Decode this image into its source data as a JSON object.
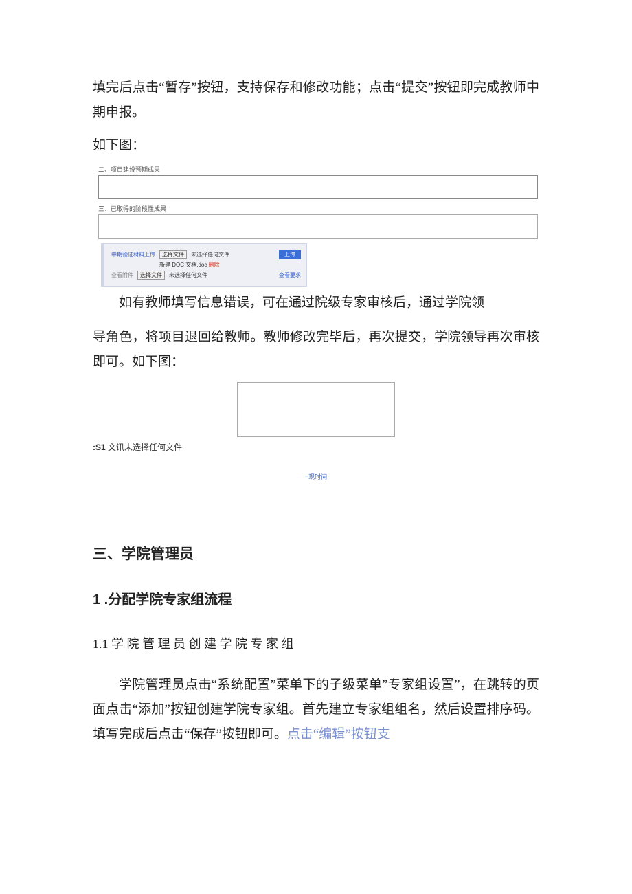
{
  "paragraphs": {
    "p1": "填完后点击“暂存”按钮，支持保存和修改功能；点击“提交”按钮即完成教师中期申报。",
    "caption1": "如下图：",
    "return1_prefix": "如有教师填写信息错误，可在通过院级专家审核后，通过学院领",
    "return2": "导角色，将项目退回给教师。教师修改完毕后，再次提交，学院领导再次审核即可。如下图：",
    "admin_para_a": "学院管理员点击“系统配置”菜单下的子级菜单”专家组设置”，在跳转的页面点击“添加”按钮创建学院专家组。首先建立专家组组名，然后设置排序码。填写完成后点击“保存”按钮即可。",
    "admin_para_b": "点击“编辑”按钮支"
  },
  "embed1": {
    "sec2_label": "二、项目建设预期成果",
    "sec3_label": "三、已取得的阶段性成果",
    "row1_label": "中期验证材料上传",
    "file_btn": "选择文件",
    "file_none": "未选择任何文件",
    "upload_btn": "上传",
    "docname_prefix": "新建 DOC 文档.doc",
    "delete": "删除",
    "row2_label": "查看附件",
    "check_req": "查看要求"
  },
  "embed2": {
    "s1_label": ":S1",
    "s1_text": "文讯未选择任何文件",
    "time_label": "=现时间"
  },
  "headings": {
    "h2": "三、学院管理员",
    "h3": "1 .分配学院专家组流程",
    "h4": "1.1   学 院 管 理 员 创 建 学 院 专 家 组"
  }
}
